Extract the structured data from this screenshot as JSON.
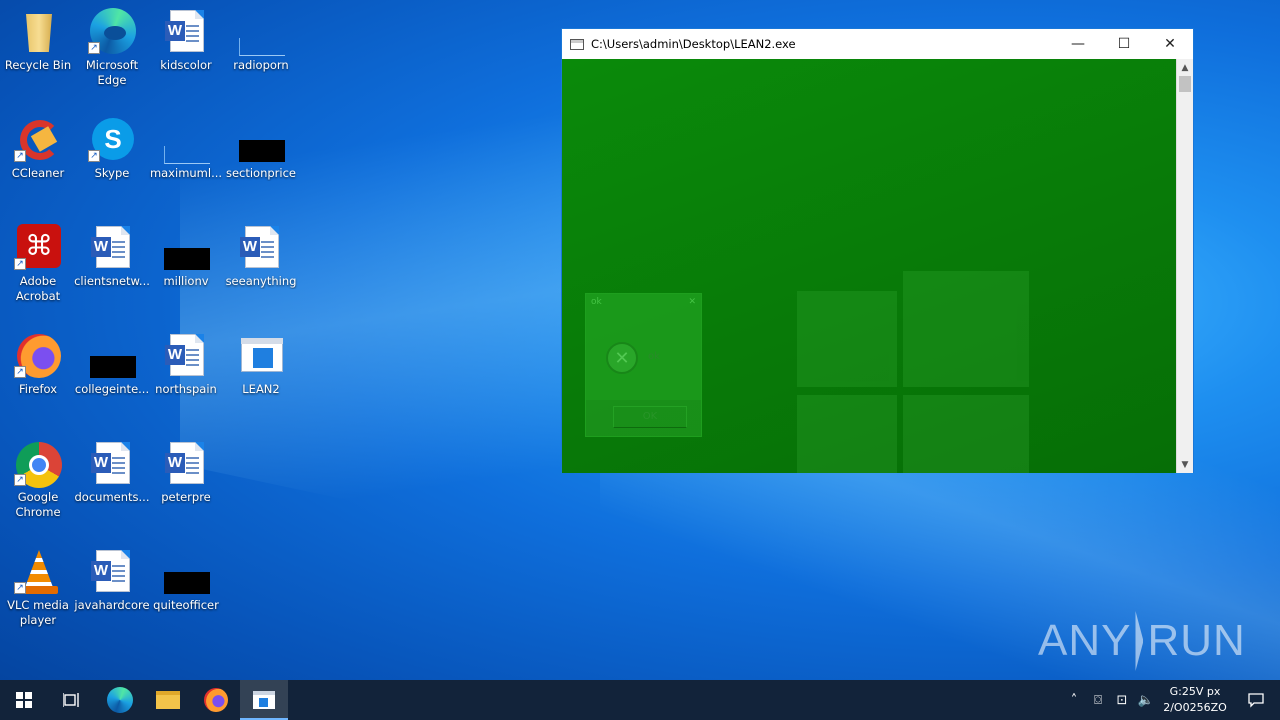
{
  "desktop": {
    "icons": [
      {
        "label": "Recycle Bin",
        "icon": "recycle-bin-icon"
      },
      {
        "label": "Microsoft Edge",
        "icon": "edge-icon"
      },
      {
        "label": "kidscolor",
        "icon": "word-doc-icon"
      },
      {
        "label": "radioporn",
        "icon": "blank-file-icon"
      },
      {
        "label": "CCleaner",
        "icon": "ccleaner-icon"
      },
      {
        "label": "Skype",
        "icon": "skype-icon"
      },
      {
        "label": "maximuml...",
        "icon": "blank-file-icon"
      },
      {
        "label": "sectionprice",
        "icon": "black-file-icon"
      },
      {
        "label": "Adobe Acrobat",
        "icon": "acrobat-icon"
      },
      {
        "label": "clientsnetw...",
        "icon": "word-doc-icon"
      },
      {
        "label": "millionv",
        "icon": "black-file-icon"
      },
      {
        "label": "seeanything",
        "icon": "word-doc-icon"
      },
      {
        "label": "Firefox",
        "icon": "firefox-icon"
      },
      {
        "label": "collegeinte...",
        "icon": "black-file-icon"
      },
      {
        "label": "northspain",
        "icon": "word-doc-icon"
      },
      {
        "label": "LEAN2",
        "icon": "app-exe-icon"
      },
      {
        "label": "Google Chrome",
        "icon": "chrome-icon"
      },
      {
        "label": "documents...",
        "icon": "word-doc-icon"
      },
      {
        "label": "peterpre",
        "icon": "word-doc-icon"
      },
      {
        "label": "VLC media player",
        "icon": "vlc-icon"
      },
      {
        "label": "javahardcore",
        "icon": "word-doc-icon"
      },
      {
        "label": "quiteofficer",
        "icon": "black-file-icon"
      }
    ]
  },
  "window": {
    "title": "C:\\Users\\admin\\Desktop\\LEAN2.exe",
    "minimize": "—",
    "maximize": "☐",
    "close": "✕",
    "msgbox": {
      "title": "ok",
      "text": "ok",
      "ok_label": "OK"
    }
  },
  "watermark": {
    "left": "ANY",
    "right": "RUN"
  },
  "taskbar": {
    "items": [
      "start",
      "task-view",
      "edge",
      "file-explorer",
      "firefox",
      "lean2"
    ],
    "clock_time": "G:25V px",
    "clock_date": "2/O0256ZO"
  },
  "colors": {
    "window_client": "#0a7d0a",
    "taskbar": "#12233a",
    "accent": "#1a78d8"
  }
}
